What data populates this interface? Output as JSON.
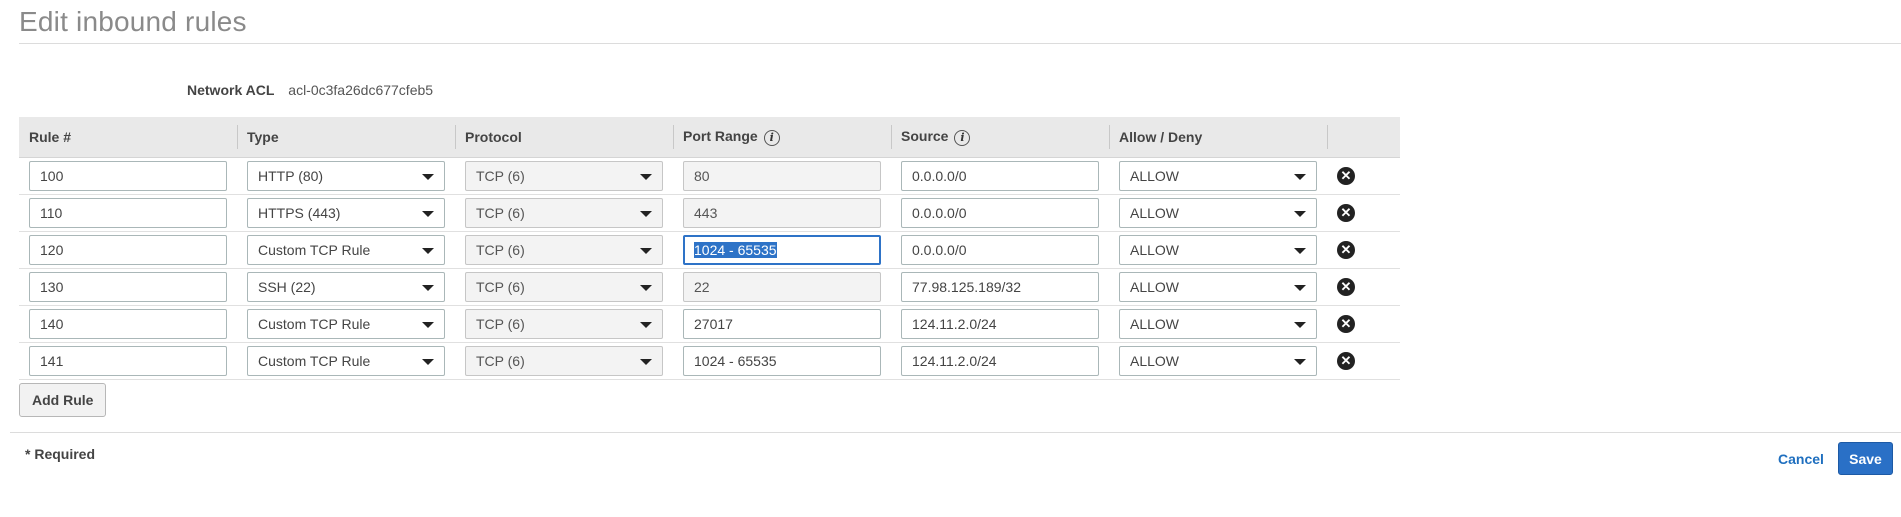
{
  "page": {
    "title": "Edit inbound rules"
  },
  "acl": {
    "label": "Network ACL",
    "value": "acl-0c3fa26dc677cfeb5"
  },
  "table": {
    "headers": {
      "rule": "Rule #",
      "type": "Type",
      "protocol": "Protocol",
      "port_range": "Port Range",
      "source": "Source",
      "allow_deny": "Allow / Deny"
    },
    "info_glyph": "i",
    "rows": [
      {
        "rule": "100",
        "type": "HTTP (80)",
        "protocol": "TCP (6)",
        "port": "80",
        "source": "0.0.0.0/0",
        "action": "ALLOW"
      },
      {
        "rule": "110",
        "type": "HTTPS (443)",
        "protocol": "TCP (6)",
        "port": "443",
        "source": "0.0.0.0/0",
        "action": "ALLOW"
      },
      {
        "rule": "120",
        "type": "Custom TCP Rule",
        "protocol": "TCP (6)",
        "port": "1024 - 65535",
        "source": "0.0.0.0/0",
        "action": "ALLOW"
      },
      {
        "rule": "130",
        "type": "SSH (22)",
        "protocol": "TCP (6)",
        "port": "22",
        "source": "77.98.125.189/32",
        "action": "ALLOW"
      },
      {
        "rule": "140",
        "type": "Custom TCP Rule",
        "protocol": "TCP (6)",
        "port": "27017",
        "source": "124.11.2.0/24",
        "action": "ALLOW"
      },
      {
        "rule": "141",
        "type": "Custom TCP Rule",
        "protocol": "TCP (6)",
        "port": "1024 - 65535",
        "source": "124.11.2.0/24",
        "action": "ALLOW"
      }
    ],
    "remove_glyph": "✕"
  },
  "actions": {
    "add_rule": "Add Rule",
    "required_note": "* Required",
    "cancel": "Cancel",
    "save": "Save"
  },
  "icons": {
    "info": "info-icon",
    "remove": "close-circle-icon",
    "dropdown": "chevron-down-icon"
  },
  "colors": {
    "accent": "#2a70c6",
    "link": "#1f6fbf",
    "header_bg": "#e9e9e9"
  }
}
